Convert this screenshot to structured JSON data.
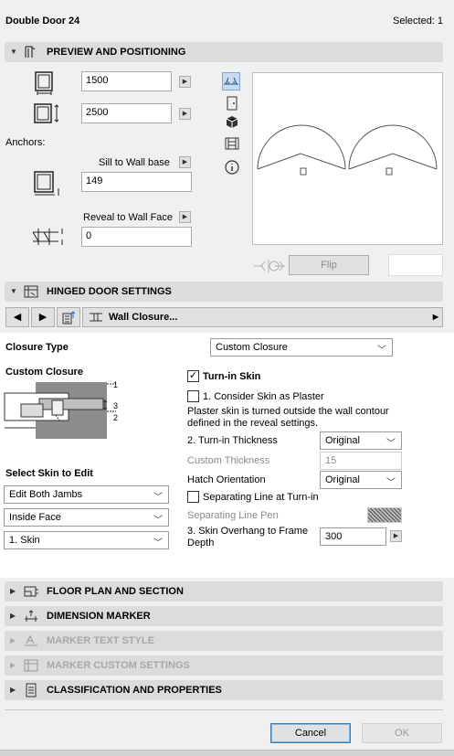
{
  "header": {
    "title": "Double Door 24",
    "selected": "Selected: 1"
  },
  "preview": {
    "section_title": "PREVIEW AND POSITIONING",
    "width_value": "1500",
    "height_value": "2500",
    "anchors_label": "Anchors:",
    "sill_label": "Sill to Wall base",
    "sill_value": "149",
    "reveal_label": "Reveal to Wall Face",
    "reveal_value": "0",
    "flip_label": "Flip"
  },
  "hinged": {
    "section_title": "HINGED DOOR SETTINGS",
    "page_label": "Wall Closure..."
  },
  "closure": {
    "type_label": "Closure Type",
    "type_value": "Custom Closure",
    "custom_label": "Custom Closure",
    "dim1": "1",
    "dim2": "2",
    "dim3": "3",
    "select_skin_label": "Select Skin to Edit",
    "skin_jambs": "Edit Both Jambs",
    "skin_face": "Inside Face",
    "skin_number": "1. Skin",
    "turn_in_skin": "Turn-in Skin",
    "turn_in_checked": true,
    "consider_plaster": "1. Consider Skin as Plaster",
    "plaster_note": "Plaster skin is turned outside the wall contour defined in the reveal settings.",
    "turn_in_thickness_label": "2. Turn-in Thickness",
    "turn_in_thickness_value": "Original",
    "custom_thickness_label": "Custom Thickness",
    "custom_thickness_value": "15",
    "hatch_label": "Hatch Orientation",
    "hatch_value": "Original",
    "separating_line": "Separating Line at Turn-in",
    "separating_pen": "Separating Line Pen",
    "overhang_label": "3. Skin Overhang to Frame Depth",
    "overhang_value": "300"
  },
  "sections": {
    "floor_plan": "FLOOR PLAN AND SECTION",
    "dimension": "DIMENSION MARKER",
    "marker_text": "MARKER TEXT STYLE",
    "marker_custom": "MARKER CUSTOM SETTINGS",
    "classification": "CLASSIFICATION AND PROPERTIES"
  },
  "footer": {
    "cancel": "Cancel",
    "ok": "OK"
  }
}
